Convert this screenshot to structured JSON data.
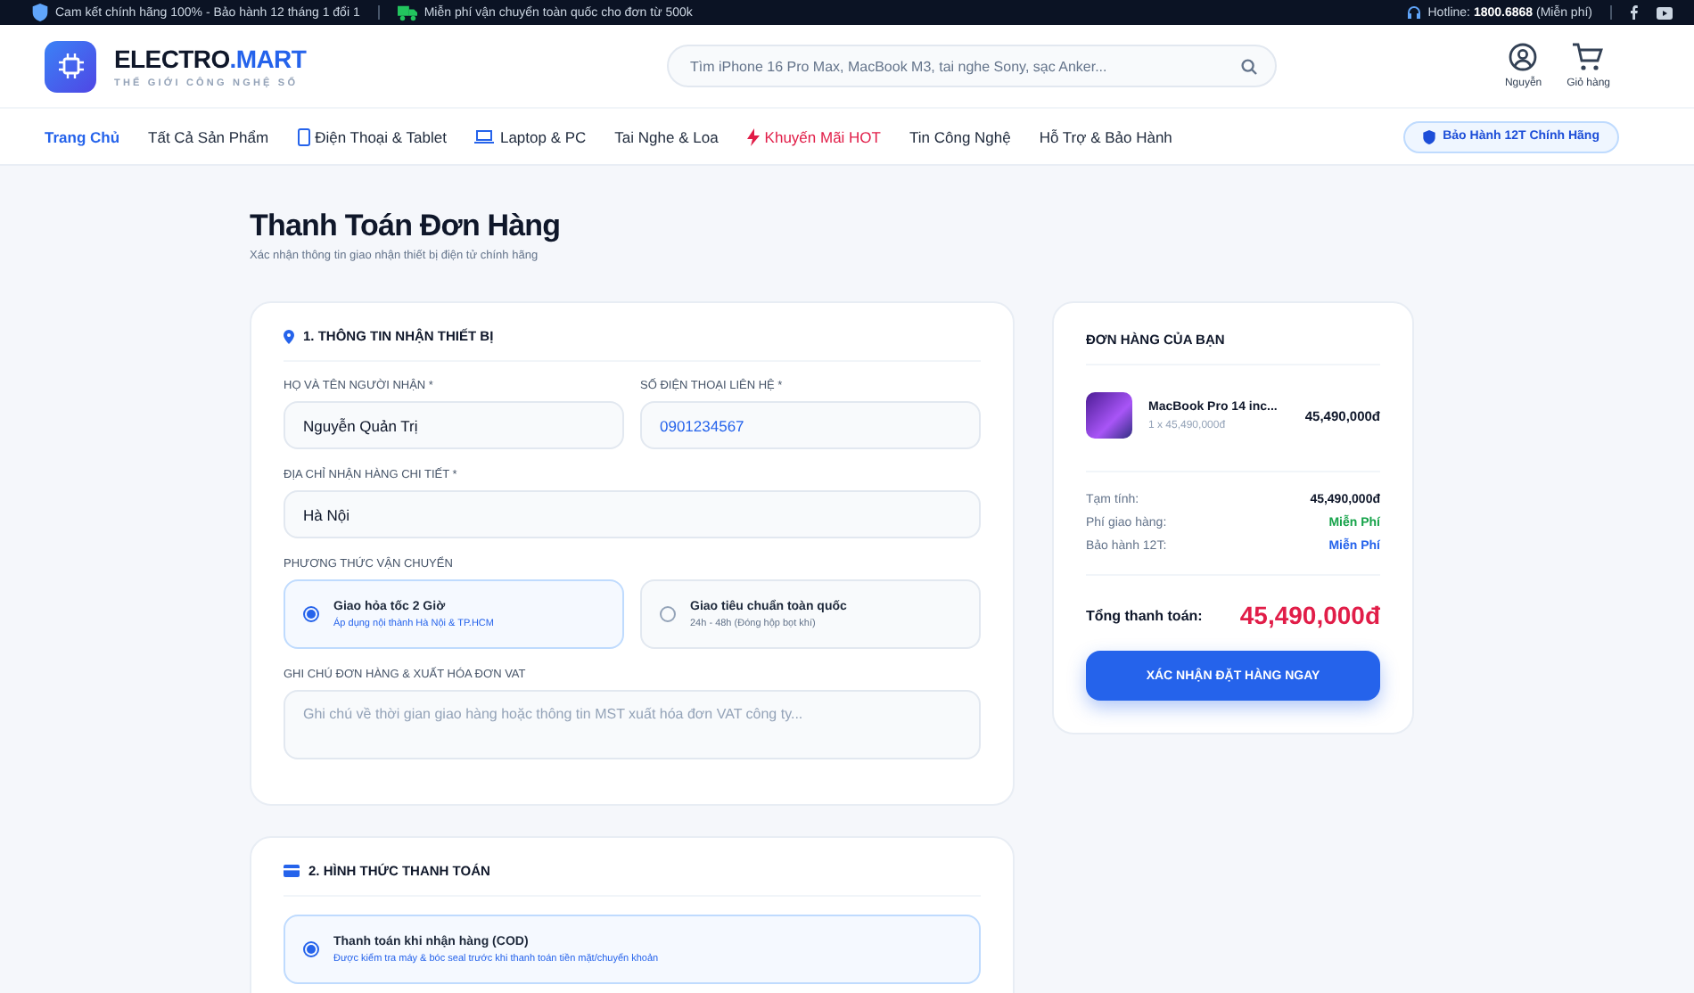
{
  "top_bar": {
    "left": [
      {
        "kind": "shield",
        "text": "Cam kết chính hãng 100% - Bảo hành 12 tháng 1 đổi 1"
      },
      {
        "kind": "truck",
        "text": "Miễn phí vận chuyển toàn quốc cho đơn từ 500k"
      }
    ],
    "hotline": {
      "label": "Hotline:",
      "number": "1800.6868",
      "note": "(Miễn phí)"
    }
  },
  "header": {
    "brand_main": "ELECTRO",
    "brand_accent": ".MART",
    "tagline": "THẾ GIỚI CÔNG NGHỆ SỐ",
    "search": {
      "placeholder": "Tìm iPhone 16 Pro Max, MacBook M3, tai nghe Sony, sạc Anker..."
    },
    "actions": [
      {
        "kind": "user",
        "label": "Nguyễn"
      },
      {
        "kind": "cart",
        "label": "Giỏ hàng"
      }
    ]
  },
  "nav": {
    "items": [
      {
        "label": "Trang Chủ",
        "kind": "plain",
        "selected": true
      },
      {
        "label": "Tất Cả Sản Phẩm",
        "kind": "plain",
        "selected": false
      },
      {
        "label": "Điện Thoại & Tablet",
        "kind": "phone",
        "selected": false
      },
      {
        "label": "Laptop & PC",
        "kind": "laptop",
        "selected": false
      },
      {
        "label": "Tai Nghe & Loa",
        "kind": "plain",
        "selected": false
      },
      {
        "label": "Khuyến Mãi HOT",
        "kind": "promo",
        "selected": false
      },
      {
        "label": "Tin Công Nghệ",
        "kind": "plain",
        "selected": false
      },
      {
        "label": "Hỗ Trợ & Bảo Hành",
        "kind": "plain",
        "selected": false
      }
    ],
    "badge": "Bảo Hành 12T Chính Hãng"
  },
  "page": {
    "title": "Thanh Toán Đơn Hàng",
    "subtitle": "Xác nhận thông tin giao nhận thiết bị điện tử chính hãng"
  },
  "shipping_section": {
    "title": "1. THÔNG TIN NHẬN THIẾT BỊ",
    "name_field": {
      "label": "HỌ VÀ TÊN NGƯỜI NHẬN *",
      "value": "Nguyễn Quản Trị"
    },
    "phone_field": {
      "label": "SỐ ĐIỆN THOẠI LIÊN HỆ *",
      "value": "0901234567"
    },
    "address_field": {
      "label": "ĐỊA CHỈ NHẬN HÀNG CHI TIẾT *",
      "value": "Hà Nội"
    },
    "method_label": "PHƯƠNG THỨC VẬN CHUYỂN",
    "methods": [
      {
        "title": "Giao hỏa tốc 2 Giờ",
        "detail": "Áp dụng nội thành Hà Nội & TP.HCM",
        "selected": true
      },
      {
        "title": "Giao tiêu chuẩn toàn quốc",
        "detail": "24h - 48h (Đóng hộp bọt khí)",
        "selected": false
      }
    ],
    "note_field": {
      "label": "GHI CHÚ ĐƠN HÀNG & XUẤT HÓA ĐƠN VAT",
      "placeholder": "Ghi chú về thời gian giao hàng hoặc thông tin MST xuất hóa đơn VAT công ty..."
    }
  },
  "payment_section": {
    "title": "2. HÌNH THỨC THANH TOÁN",
    "options": [
      {
        "title": "Thanh toán khi nhận hàng (COD)",
        "detail": "Được kiểm tra máy & bóc seal trước khi thanh toán tiền mặt/chuyển khoản",
        "selected": true
      }
    ]
  },
  "order_summary": {
    "title": "ĐƠN HÀNG CỦA BẠN",
    "items": [
      {
        "name": "MacBook Pro 14 inc...",
        "qty_price": "1 x 45,490,000đ",
        "total": "45,490,000đ"
      }
    ],
    "rows": [
      {
        "label": "Tạm tính:",
        "value": "45,490,000đ"
      },
      {
        "label": "Phí giao hàng:",
        "value": "Miễn Phí",
        "color": "#16a34a"
      },
      {
        "label": "Bảo hành 12T:",
        "value": "Miễn Phí",
        "color": "#2563eb"
      }
    ],
    "total_label": "Tổng thanh toán:",
    "total_value": "45,490,000đ",
    "confirm_button": "XÁC NHẬN ĐẶT HÀNG NGAY"
  }
}
